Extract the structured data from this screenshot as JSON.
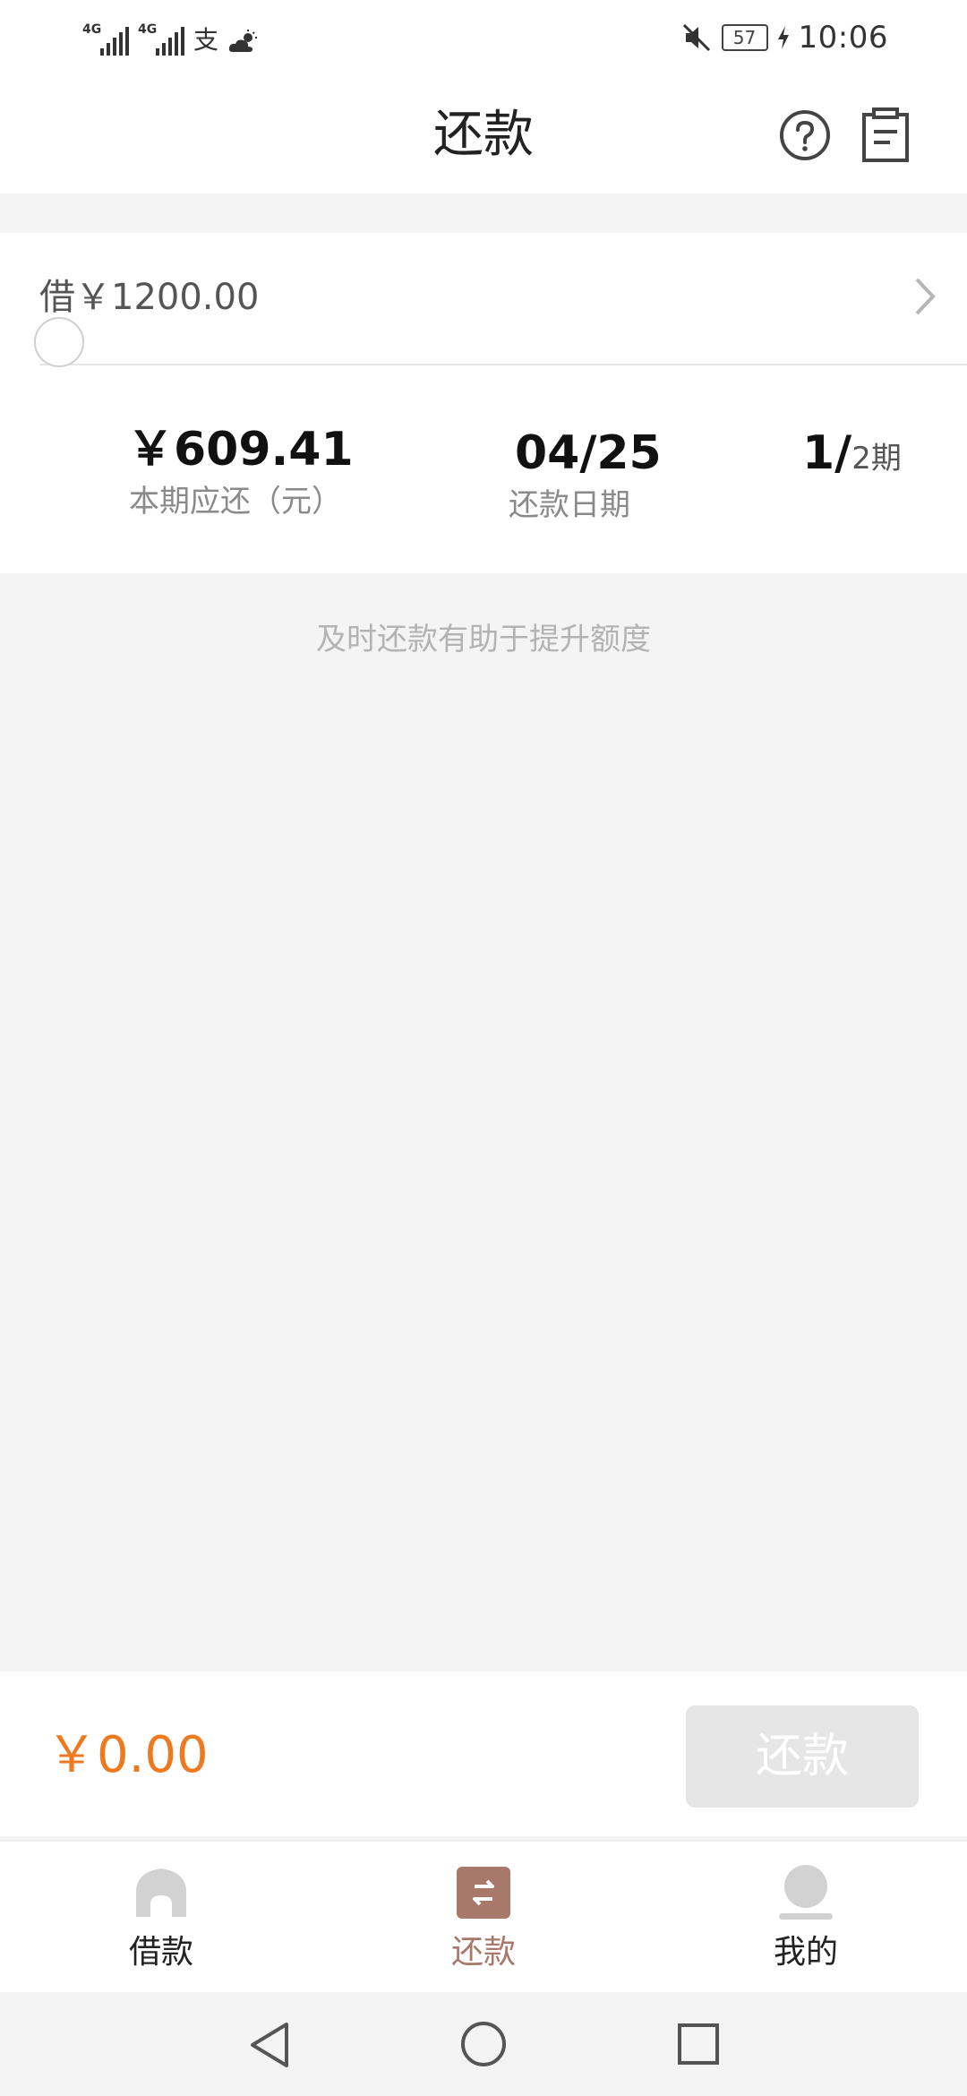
{
  "status_bar": {
    "signal1_label": "4G",
    "signal2_label": "4G",
    "alipay_icon": "支",
    "weather_icon": "cloud-sun-icon",
    "mute_icon": "mute-icon",
    "battery": "57",
    "charging_icon": "bolt-icon",
    "time": "10:06"
  },
  "header": {
    "title": "还款",
    "help_icon": "question-circle-icon",
    "bill_icon": "bill-list-icon"
  },
  "loan": {
    "summary": "借￥1200.00",
    "installment": {
      "amount_due": "￥609.41",
      "amount_due_label": "本期应还（元）",
      "due_date": "04/25",
      "due_date_label": "还款日期",
      "period_current": "1/",
      "period_total": "2期"
    }
  },
  "tip": "及时还款有助于提升额度",
  "pay_bar": {
    "total": "￥0.00",
    "button_label": "还款"
  },
  "tabs": [
    {
      "label": "借款",
      "icon": "home-icon"
    },
    {
      "label": "还款",
      "icon": "repay-icon",
      "active": true
    },
    {
      "label": "我的",
      "icon": "profile-icon"
    }
  ],
  "colors": {
    "accent_orange": "#ed7a1f",
    "active_tab": "#a8786a",
    "disabled_button": "#e6e6e6"
  }
}
